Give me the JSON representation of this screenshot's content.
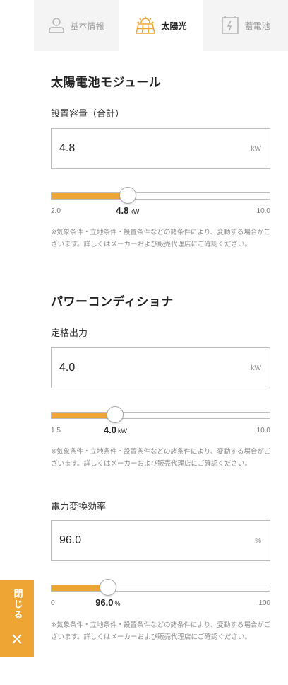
{
  "tabs": [
    {
      "label": "基本情報",
      "icon": "person-icon",
      "active": false
    },
    {
      "label": "太陽光",
      "icon": "solar-panel-icon",
      "active": true
    },
    {
      "label": "蓄電池",
      "icon": "battery-icon",
      "active": false
    }
  ],
  "accent_color": "#eea534",
  "module": {
    "title": "太陽電池モジュール",
    "capacity": {
      "label": "設置容量（合計）",
      "value": "4.8",
      "unit": "kW",
      "slider_min": "2.0",
      "slider_max": "10.0",
      "slider_value": 4.8,
      "slider_min_num": 2.0,
      "slider_max_num": 10.0,
      "current_label": "4.8",
      "current_unit": "kW",
      "note": "※気象条件・立地条件・設置条件などの諸条件により、変動する場合がございます。詳しくはメーカーおよび販売代理店にご確認ください。"
    }
  },
  "conditioner": {
    "title": "パワーコンディショナ",
    "rated_output": {
      "label": "定格出力",
      "value": "4.0",
      "unit": "kW",
      "slider_min": "1.5",
      "slider_max": "10.0",
      "slider_value": 4.0,
      "slider_min_num": 1.5,
      "slider_max_num": 10.0,
      "current_label": "4.0",
      "current_unit": "kW",
      "note": "※気象条件・立地条件・設置条件などの諸条件により、変動する場合がございます。詳しくはメーカーおよび販売代理店にご確認ください。"
    },
    "efficiency": {
      "label": "電力変換効率",
      "value": "96.0",
      "unit": "%",
      "slider_min": "0",
      "slider_max": "100",
      "slider_value": 26.0,
      "slider_min_num": 0,
      "slider_max_num": 100,
      "current_label": "96.0",
      "current_unit": "%",
      "note": "※気象条件・立地条件・設置条件などの諸条件により、変動する場合がございます。詳しくはメーカーおよび販売代理店にご確認ください。"
    }
  },
  "close_button": {
    "label": "閉じる",
    "icon": "close-icon"
  }
}
